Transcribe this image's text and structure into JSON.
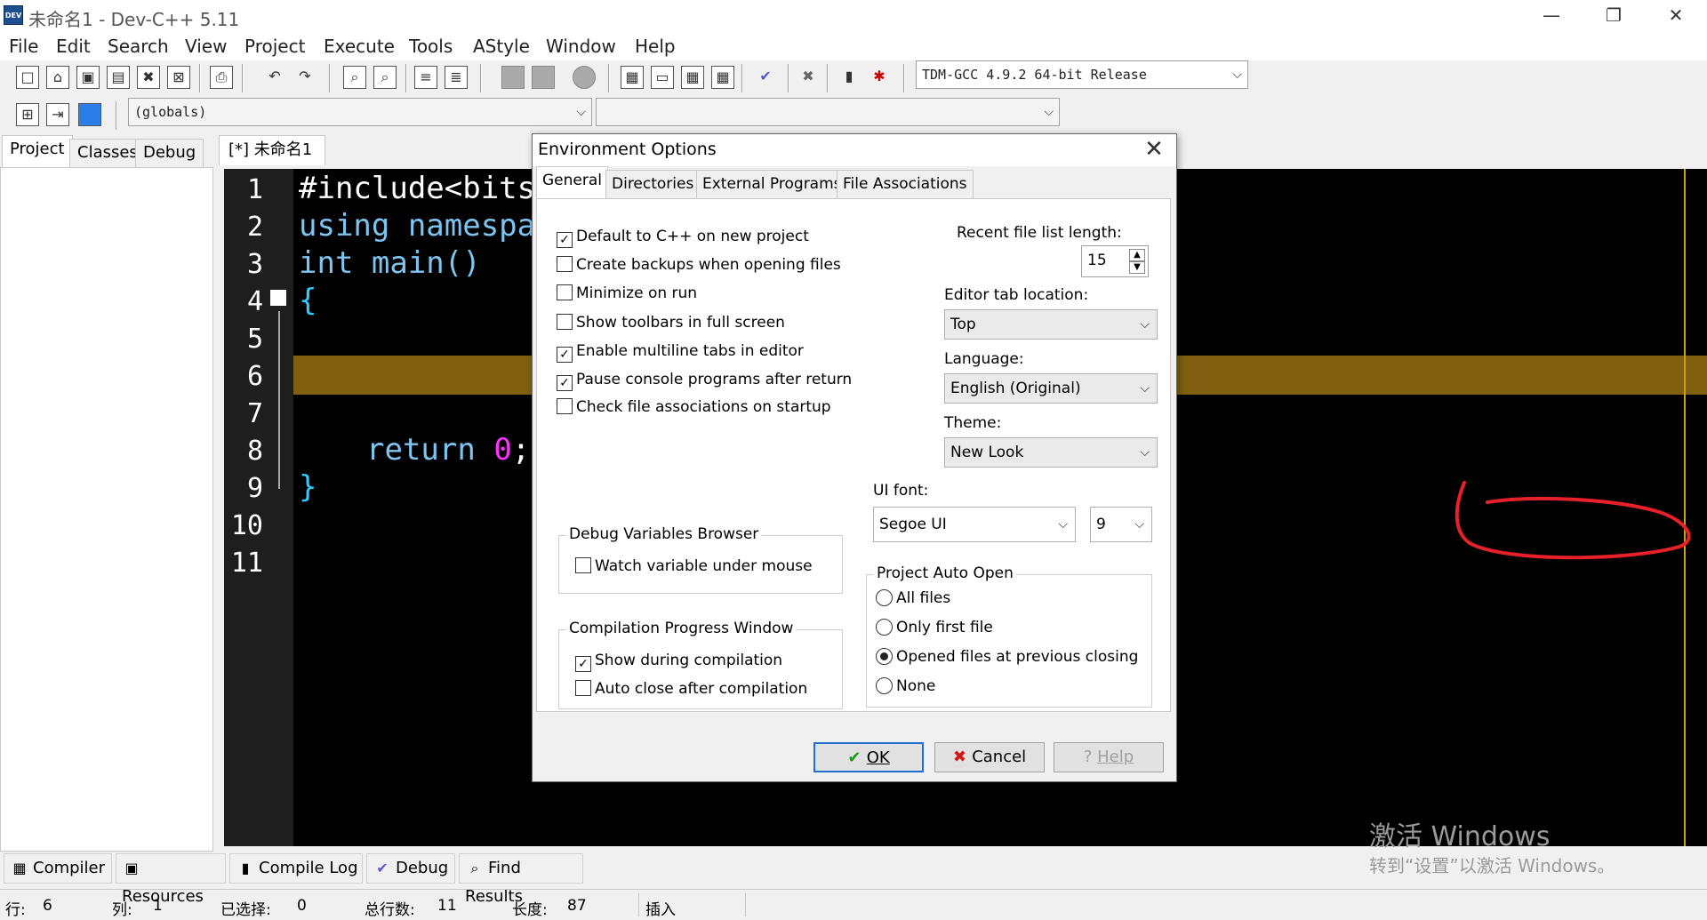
{
  "window": {
    "title": "未命名1 - Dev-C++ 5.11",
    "app_icon_text": "DEV",
    "minimize": "—",
    "restore": "❐",
    "close": "✕"
  },
  "menu": [
    "File",
    "Edit",
    "Search",
    "View",
    "Project",
    "Execute",
    "Tools",
    "AStyle",
    "Window",
    "Help"
  ],
  "toolbar": {
    "compiler_select": "TDM-GCC 4.9.2 64-bit Release",
    "scope_select": "(globals)",
    "function_select": ""
  },
  "left_tabs": [
    "Project",
    "Classes",
    "Debug"
  ],
  "editor": {
    "tab_label": "[*] 未命名1",
    "lines": [
      "1",
      "2",
      "3",
      "4",
      "5",
      "6",
      "7",
      "8",
      "9",
      "10",
      "11"
    ],
    "code": {
      "l1": "#include<bits/",
      "l2": "using namespac",
      "l3_kw": "int",
      "l3_rest": " main()",
      "l4": "{",
      "l8_kw": "return",
      "l8_num": "0",
      "l8_semi": ";",
      "l9": "}"
    }
  },
  "dialog": {
    "title": "Environment Options",
    "tabs": [
      "General",
      "Directories",
      "External Programs",
      "File Associations"
    ],
    "checkboxes": {
      "default_cpp": {
        "label": "Default to C++ on new project",
        "checked": true
      },
      "create_backups": {
        "label": "Create backups when opening files",
        "checked": false
      },
      "minimize_on_run": {
        "label": "Minimize on run",
        "checked": false
      },
      "show_toolbars": {
        "label": "Show toolbars in full screen",
        "checked": false
      },
      "multiline_tabs": {
        "label": "Enable multiline tabs in editor",
        "checked": true
      },
      "pause_console": {
        "label": "Pause console programs after return",
        "checked": true
      },
      "check_assoc": {
        "label": "Check file associations on startup",
        "checked": false
      }
    },
    "recent_label": "Recent file list length:",
    "recent_value": "15",
    "tab_location_label": "Editor tab location:",
    "tab_location_value": "Top",
    "language_label": "Language:",
    "language_value": "English (Original)",
    "theme_label": "Theme:",
    "theme_value": "New Look",
    "ui_font_label": "UI font:",
    "ui_font_value": "Segoe UI",
    "ui_font_size": "9",
    "debug_group": {
      "title": "Debug Variables Browser",
      "watch_label": "Watch variable under mouse",
      "watch_checked": false
    },
    "compile_group": {
      "title": "Compilation Progress Window",
      "show_label": "Show during compilation",
      "show_checked": true,
      "autoclose_label": "Auto close after compilation",
      "autoclose_checked": false
    },
    "auto_open": {
      "title": "Project Auto Open",
      "options": [
        "All files",
        "Only first file",
        "Opened files at previous closing",
        "None"
      ],
      "selected": "Opened files at previous closing"
    },
    "buttons": {
      "ok": "OK",
      "cancel": "Cancel",
      "help": "Help"
    },
    "annotation_color": "#e8202a"
  },
  "bottom_tabs": [
    "Compiler",
    "Resources",
    "Compile Log",
    "Debug",
    "Find Results"
  ],
  "status": {
    "row_label": "行:",
    "row_value": "6",
    "col_label": "列:",
    "col_value": "1",
    "sel_label": "已选择:",
    "sel_value": "0",
    "total_label": "总行数:",
    "total_value": "11",
    "len_label": "长度:",
    "len_value": "87",
    "mode": "插入"
  },
  "watermark": {
    "line1": "激活 Windows",
    "line2": "转到“设置”以激活 Windows。"
  },
  "colors": {
    "editor_bg": "#000000",
    "current_line": "#806010",
    "code_text": "#ffffff",
    "keyword": "#7ec4f0",
    "brace": "#33ccff",
    "number": "#ff33ff",
    "annotation": "#e8202a"
  }
}
